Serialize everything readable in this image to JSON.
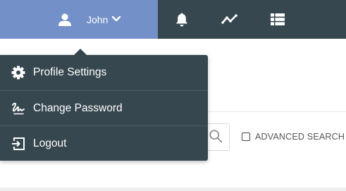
{
  "header": {
    "user_name": "John",
    "icons": [
      "user-icon",
      "chevron-down-icon",
      "bell-icon",
      "activity-chart-icon",
      "list-icon"
    ],
    "colors": {
      "bar": "#37474f",
      "user_tab": "#7390c8"
    }
  },
  "user_menu": {
    "items": [
      {
        "icon": "gear-icon",
        "label": "Profile Settings"
      },
      {
        "icon": "signature-icon",
        "label": "Change Password"
      },
      {
        "icon": "logout-icon",
        "label": "Logout"
      }
    ],
    "background": "#37474f"
  },
  "search": {
    "icon": "search-icon",
    "advanced_label": "ADVANCED SEARCH",
    "advanced_checked": false
  }
}
